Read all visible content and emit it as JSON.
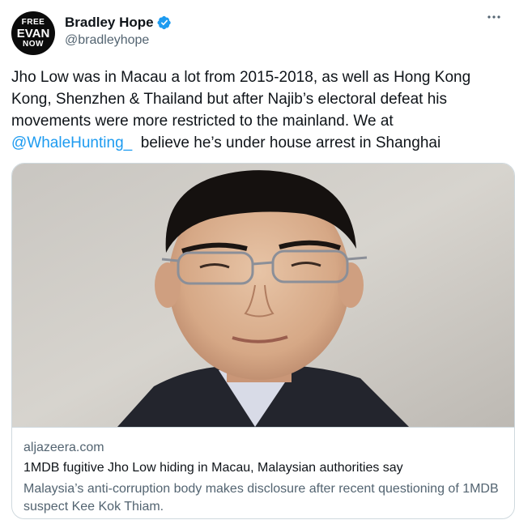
{
  "author": {
    "avatar_lines": [
      "FREE",
      "EVAN",
      "NOW"
    ],
    "display_name": "Bradley Hope",
    "handle": "@bradleyhope",
    "verified_icon": "verified-badge-icon"
  },
  "more_icon": "more-options-icon",
  "tweet": {
    "text_before": "Jho Low was in Macau a lot from 2015-2018, as well as Hong Kong Kong, Shenzhen & Thailand but after Najib’s electoral defeat his movements were more restricted to the mainland. We at ",
    "mention": "@WhaleHunting_",
    "text_after": "  believe he’s under house arrest in Shanghai"
  },
  "link_card": {
    "domain": "aljazeera.com",
    "title": "1MDB fugitive Jho Low hiding in Macau, Malaysian authorities say",
    "description": "Malaysia’s anti-corruption body makes disclosure after recent questioning of 1MDB suspect Kee Kok Thiam."
  },
  "colors": {
    "accent": "#1d9bf0",
    "text": "#0f1419",
    "secondary": "#536471",
    "border": "#cfd9de"
  }
}
